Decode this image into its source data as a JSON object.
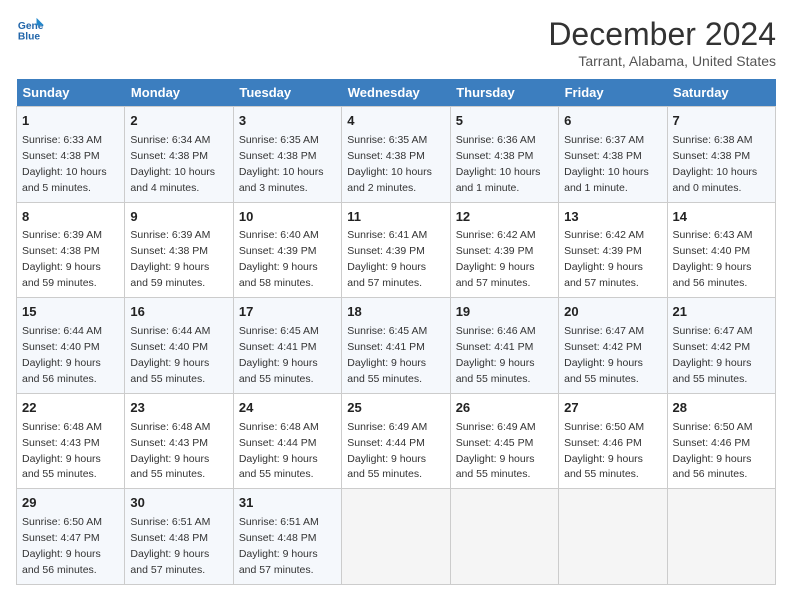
{
  "header": {
    "logo_line1": "General",
    "logo_line2": "Blue",
    "title": "December 2024",
    "subtitle": "Tarrant, Alabama, United States"
  },
  "calendar": {
    "weekdays": [
      "Sunday",
      "Monday",
      "Tuesday",
      "Wednesday",
      "Thursday",
      "Friday",
      "Saturday"
    ],
    "weeks": [
      [
        {
          "day": "1",
          "detail": "Sunrise: 6:33 AM\nSunset: 4:38 PM\nDaylight: 10 hours\nand 5 minutes."
        },
        {
          "day": "2",
          "detail": "Sunrise: 6:34 AM\nSunset: 4:38 PM\nDaylight: 10 hours\nand 4 minutes."
        },
        {
          "day": "3",
          "detail": "Sunrise: 6:35 AM\nSunset: 4:38 PM\nDaylight: 10 hours\nand 3 minutes."
        },
        {
          "day": "4",
          "detail": "Sunrise: 6:35 AM\nSunset: 4:38 PM\nDaylight: 10 hours\nand 2 minutes."
        },
        {
          "day": "5",
          "detail": "Sunrise: 6:36 AM\nSunset: 4:38 PM\nDaylight: 10 hours\nand 1 minute."
        },
        {
          "day": "6",
          "detail": "Sunrise: 6:37 AM\nSunset: 4:38 PM\nDaylight: 10 hours\nand 1 minute."
        },
        {
          "day": "7",
          "detail": "Sunrise: 6:38 AM\nSunset: 4:38 PM\nDaylight: 10 hours\nand 0 minutes."
        }
      ],
      [
        {
          "day": "8",
          "detail": "Sunrise: 6:39 AM\nSunset: 4:38 PM\nDaylight: 9 hours\nand 59 minutes."
        },
        {
          "day": "9",
          "detail": "Sunrise: 6:39 AM\nSunset: 4:38 PM\nDaylight: 9 hours\nand 59 minutes."
        },
        {
          "day": "10",
          "detail": "Sunrise: 6:40 AM\nSunset: 4:39 PM\nDaylight: 9 hours\nand 58 minutes."
        },
        {
          "day": "11",
          "detail": "Sunrise: 6:41 AM\nSunset: 4:39 PM\nDaylight: 9 hours\nand 57 minutes."
        },
        {
          "day": "12",
          "detail": "Sunrise: 6:42 AM\nSunset: 4:39 PM\nDaylight: 9 hours\nand 57 minutes."
        },
        {
          "day": "13",
          "detail": "Sunrise: 6:42 AM\nSunset: 4:39 PM\nDaylight: 9 hours\nand 57 minutes."
        },
        {
          "day": "14",
          "detail": "Sunrise: 6:43 AM\nSunset: 4:40 PM\nDaylight: 9 hours\nand 56 minutes."
        }
      ],
      [
        {
          "day": "15",
          "detail": "Sunrise: 6:44 AM\nSunset: 4:40 PM\nDaylight: 9 hours\nand 56 minutes."
        },
        {
          "day": "16",
          "detail": "Sunrise: 6:44 AM\nSunset: 4:40 PM\nDaylight: 9 hours\nand 55 minutes."
        },
        {
          "day": "17",
          "detail": "Sunrise: 6:45 AM\nSunset: 4:41 PM\nDaylight: 9 hours\nand 55 minutes."
        },
        {
          "day": "18",
          "detail": "Sunrise: 6:45 AM\nSunset: 4:41 PM\nDaylight: 9 hours\nand 55 minutes."
        },
        {
          "day": "19",
          "detail": "Sunrise: 6:46 AM\nSunset: 4:41 PM\nDaylight: 9 hours\nand 55 minutes."
        },
        {
          "day": "20",
          "detail": "Sunrise: 6:47 AM\nSunset: 4:42 PM\nDaylight: 9 hours\nand 55 minutes."
        },
        {
          "day": "21",
          "detail": "Sunrise: 6:47 AM\nSunset: 4:42 PM\nDaylight: 9 hours\nand 55 minutes."
        }
      ],
      [
        {
          "day": "22",
          "detail": "Sunrise: 6:48 AM\nSunset: 4:43 PM\nDaylight: 9 hours\nand 55 minutes."
        },
        {
          "day": "23",
          "detail": "Sunrise: 6:48 AM\nSunset: 4:43 PM\nDaylight: 9 hours\nand 55 minutes."
        },
        {
          "day": "24",
          "detail": "Sunrise: 6:48 AM\nSunset: 4:44 PM\nDaylight: 9 hours\nand 55 minutes."
        },
        {
          "day": "25",
          "detail": "Sunrise: 6:49 AM\nSunset: 4:44 PM\nDaylight: 9 hours\nand 55 minutes."
        },
        {
          "day": "26",
          "detail": "Sunrise: 6:49 AM\nSunset: 4:45 PM\nDaylight: 9 hours\nand 55 minutes."
        },
        {
          "day": "27",
          "detail": "Sunrise: 6:50 AM\nSunset: 4:46 PM\nDaylight: 9 hours\nand 55 minutes."
        },
        {
          "day": "28",
          "detail": "Sunrise: 6:50 AM\nSunset: 4:46 PM\nDaylight: 9 hours\nand 56 minutes."
        }
      ],
      [
        {
          "day": "29",
          "detail": "Sunrise: 6:50 AM\nSunset: 4:47 PM\nDaylight: 9 hours\nand 56 minutes."
        },
        {
          "day": "30",
          "detail": "Sunrise: 6:51 AM\nSunset: 4:48 PM\nDaylight: 9 hours\nand 57 minutes."
        },
        {
          "day": "31",
          "detail": "Sunrise: 6:51 AM\nSunset: 4:48 PM\nDaylight: 9 hours\nand 57 minutes."
        },
        {
          "day": "",
          "detail": ""
        },
        {
          "day": "",
          "detail": ""
        },
        {
          "day": "",
          "detail": ""
        },
        {
          "day": "",
          "detail": ""
        }
      ]
    ]
  }
}
